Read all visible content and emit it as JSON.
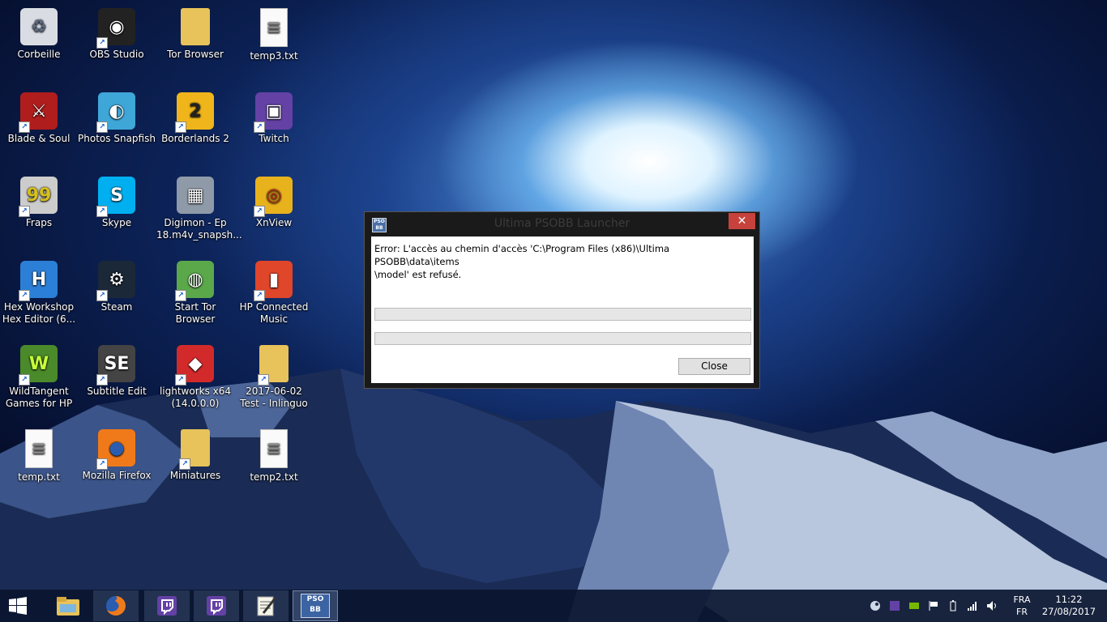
{
  "desktop": {
    "icons": [
      {
        "label": "Corbeille",
        "icon": "recycle-bin-icon"
      },
      {
        "label": "OBS Studio",
        "icon": "obs-icon"
      },
      {
        "label": "Tor Browser",
        "icon": "folder-icon"
      },
      {
        "label": "temp3.txt",
        "icon": "text-file-icon"
      },
      {
        "label": "Blade & Soul",
        "icon": "blade-soul-icon"
      },
      {
        "label": "Photos Snapfish",
        "icon": "snapfish-icon"
      },
      {
        "label": "Borderlands 2",
        "icon": "borderlands-icon"
      },
      {
        "label": "Twitch",
        "icon": "twitch-icon"
      },
      {
        "label": "Fraps",
        "icon": "fraps-icon"
      },
      {
        "label": "Skype",
        "icon": "skype-icon"
      },
      {
        "label": "Digimon - Ep 18.m4v_snapsh...",
        "icon": "image-file-icon"
      },
      {
        "label": "XnView",
        "icon": "xnview-icon"
      },
      {
        "label": "Hex Workshop Hex Editor (6...",
        "icon": "hex-workshop-icon"
      },
      {
        "label": "Steam",
        "icon": "steam-icon"
      },
      {
        "label": "Start Tor Browser",
        "icon": "tor-globe-icon"
      },
      {
        "label": "HP Connected Music",
        "icon": "hp-music-icon"
      },
      {
        "label": "WildTangent Games for HP",
        "icon": "wildtangent-icon"
      },
      {
        "label": "Subtitle Edit",
        "icon": "subtitle-edit-icon"
      },
      {
        "label": "lightworks x64 (14.0.0.0)",
        "icon": "lightworks-icon"
      },
      {
        "label": "2017-06-02 Test - Inlinguo",
        "icon": "folder-icon"
      },
      {
        "label": "temp.txt",
        "icon": "text-file-icon"
      },
      {
        "label": "Mozilla Firefox",
        "icon": "firefox-icon"
      },
      {
        "label": "Miniatures",
        "icon": "folder-icon"
      },
      {
        "label": "temp2.txt",
        "icon": "text-file-icon"
      }
    ]
  },
  "dialog": {
    "title": "Ultima PSOBB Launcher",
    "icon_text": "PSO BB",
    "close_glyph": "✕",
    "message_line1": "Error: L'accès au chemin d'accès 'C:\\Program Files (x86)\\Ultima PSOBB\\data\\items",
    "message_line2": "\\model' est refusé.",
    "progress1": 0,
    "progress2": 0,
    "close_button": "Close"
  },
  "taskbar": {
    "items": [
      {
        "name": "start",
        "icon": "windows-logo-icon"
      },
      {
        "name": "file-explorer",
        "icon": "file-explorer-icon"
      },
      {
        "name": "firefox",
        "icon": "firefox-icon"
      },
      {
        "name": "twitch-1",
        "icon": "twitch-icon"
      },
      {
        "name": "twitch-2",
        "icon": "twitch-icon"
      },
      {
        "name": "notepad",
        "icon": "notepad-icon"
      },
      {
        "name": "psobb",
        "icon": "psobb-icon",
        "label": "PSO BB"
      }
    ],
    "tray": {
      "language_top": "FRA",
      "language_bottom": "FR",
      "time": "11:22",
      "date": "27/08/2017"
    }
  },
  "colors": {
    "dialog_close": "#c7423c",
    "twitch": "#6441a5",
    "taskbar": "#0a1630"
  }
}
